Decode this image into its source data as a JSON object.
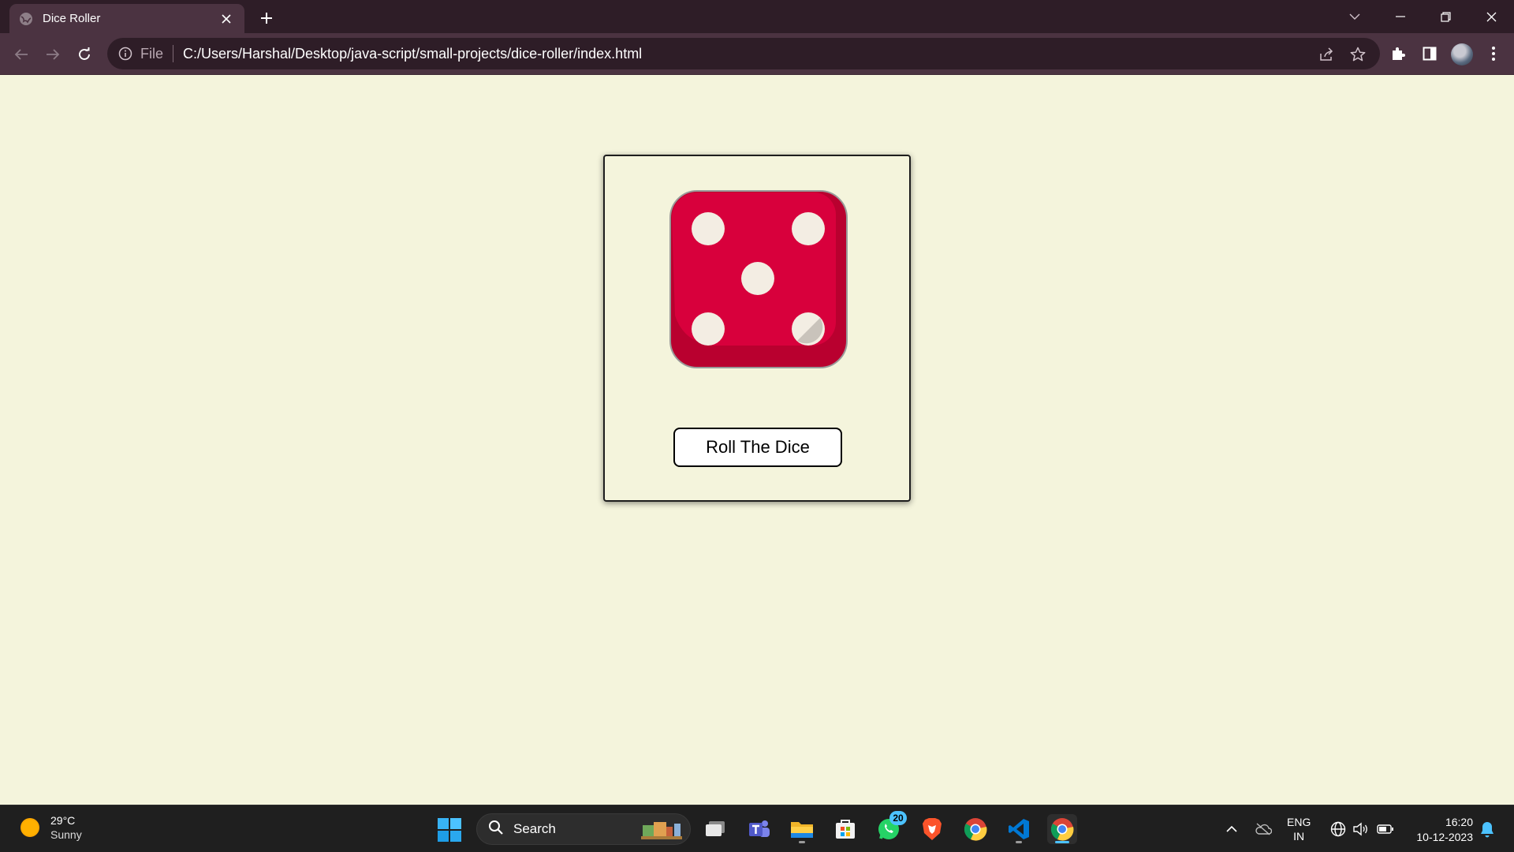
{
  "browser": {
    "tab_title": "Dice Roller",
    "omnibox": {
      "scheme_label": "File",
      "url": "C:/Users/Harshal/Desktop/java-script/small-projects/dice-roller/index.html"
    }
  },
  "page": {
    "dice_face_value": 5,
    "dice_color": "#d8003c",
    "pip_color": "#f3ede3",
    "roll_button_label": "Roll The Dice",
    "background_color": "#f4f4dc"
  },
  "taskbar": {
    "weather": {
      "temperature": "29°C",
      "condition": "Sunny"
    },
    "search_label": "Search",
    "apps": [
      "task-view",
      "teams",
      "file-explorer",
      "microsoft-store",
      "whatsapp",
      "brave",
      "chrome",
      "vscode",
      "chrome-active"
    ],
    "whatsapp_badge": "20",
    "language": {
      "line1": "ENG",
      "line2": "IN"
    },
    "clock": {
      "time": "16:20",
      "date": "10-12-2023"
    }
  }
}
